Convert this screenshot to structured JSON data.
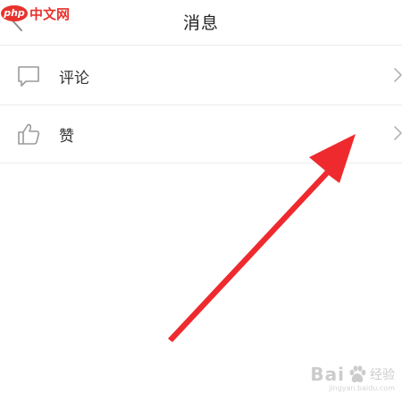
{
  "nav": {
    "title": "消息",
    "back_icon": "chevron-left-icon"
  },
  "rows": [
    {
      "label": "评论",
      "icon": "comment-icon"
    },
    {
      "label": "赞",
      "icon": "thumbs-up-icon"
    }
  ],
  "watermark": {
    "logo_badge": "php",
    "logo_text": "中文网",
    "baidu_prefix": "Bai",
    "baidu_suffix": "经验",
    "baidu_url": "jingyan.baidu.com"
  },
  "colors": {
    "accent": "#e8322d",
    "divider": "#ececec",
    "icon_gray": "#9a9a9a",
    "text": "#333333"
  }
}
